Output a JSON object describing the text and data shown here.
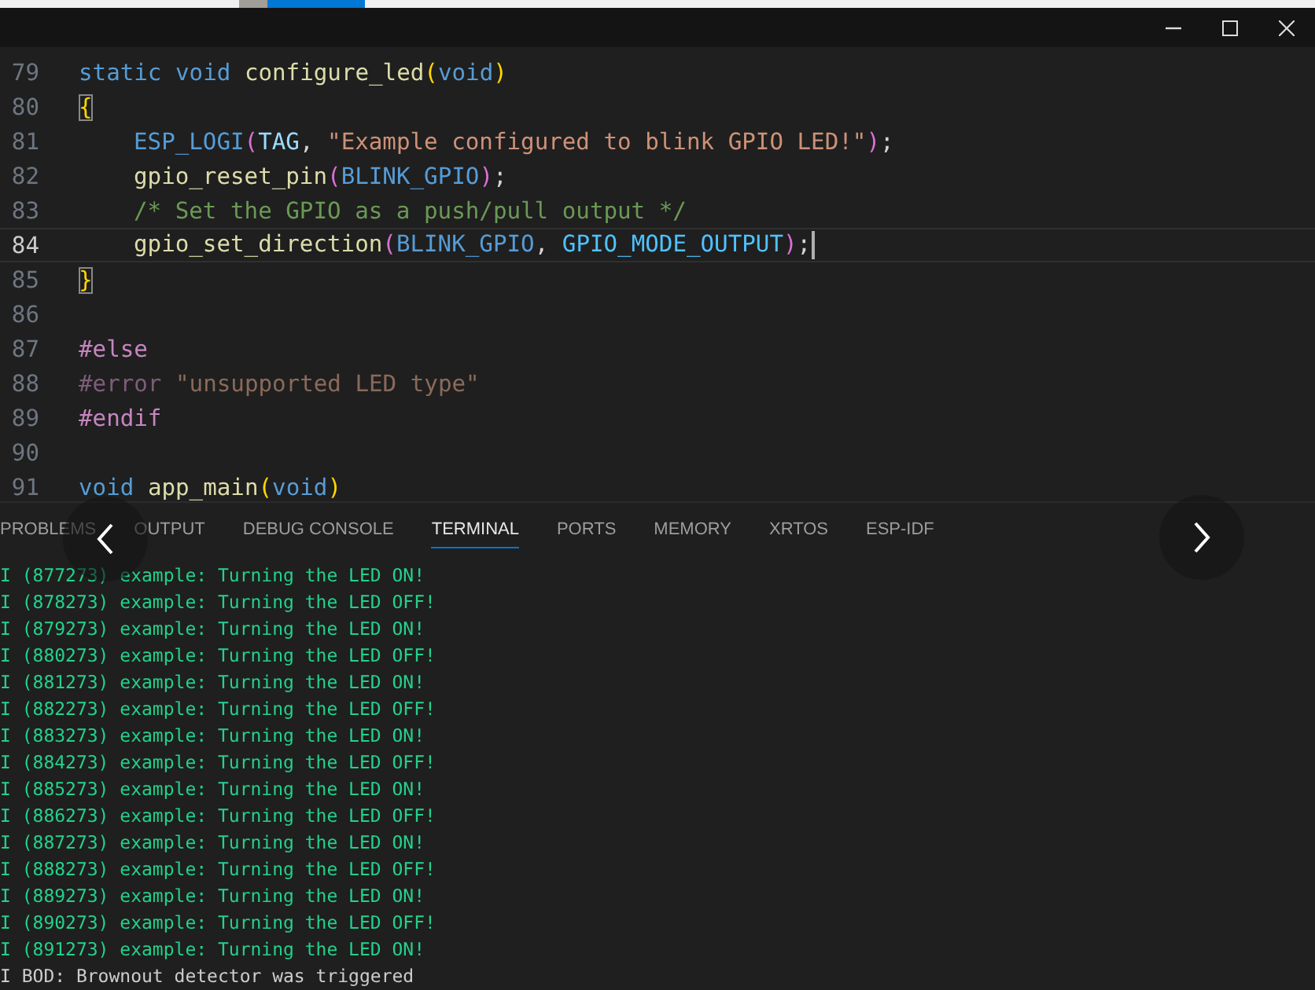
{
  "window": {
    "controls": [
      {
        "kind": "minimize"
      },
      {
        "kind": "maximize"
      },
      {
        "kind": "close"
      }
    ]
  },
  "editor": {
    "lines": [
      {
        "number": "79",
        "current": false,
        "tokens": [
          {
            "kind": "keyword",
            "text": "static void "
          },
          {
            "kind": "function",
            "text": "configure_led"
          },
          {
            "kind": "paren",
            "text": "("
          },
          {
            "kind": "keyword",
            "text": "void"
          },
          {
            "kind": "paren",
            "text": ")"
          }
        ]
      },
      {
        "number": "80",
        "current": false,
        "tokens": [
          {
            "kind": "match",
            "text": "{"
          }
        ]
      },
      {
        "number": "81",
        "current": false,
        "indented": true,
        "tokens": [
          {
            "kind": "macro",
            "text": "ESP_LOGI"
          },
          {
            "kind": "paren2",
            "text": "("
          },
          {
            "kind": "variable",
            "text": "TAG"
          },
          {
            "kind": "plain",
            "text": ", "
          },
          {
            "kind": "string",
            "text": "\"Example configured to blink GPIO LED!\""
          },
          {
            "kind": "paren2",
            "text": ")"
          },
          {
            "kind": "plain",
            "text": ";"
          }
        ]
      },
      {
        "number": "82",
        "current": false,
        "indented": true,
        "tokens": [
          {
            "kind": "function",
            "text": "gpio_reset_pin"
          },
          {
            "kind": "paren2",
            "text": "("
          },
          {
            "kind": "macro",
            "text": "BLINK_GPIO"
          },
          {
            "kind": "paren2",
            "text": ")"
          },
          {
            "kind": "plain",
            "text": ";"
          }
        ]
      },
      {
        "number": "83",
        "current": false,
        "indented": true,
        "tokens": [
          {
            "kind": "comment",
            "text": "/* Set the GPIO as a push/pull output */"
          }
        ]
      },
      {
        "number": "84",
        "current": true,
        "indented": true,
        "tokens": [
          {
            "kind": "function",
            "text": "gpio_set_direction"
          },
          {
            "kind": "paren2",
            "text": "("
          },
          {
            "kind": "macro",
            "text": "BLINK_GPIO"
          },
          {
            "kind": "plain",
            "text": ", "
          },
          {
            "kind": "constant",
            "text": "GPIO_MODE_OUTPUT"
          },
          {
            "kind": "paren2",
            "text": ")"
          },
          {
            "kind": "plain",
            "text": ";"
          }
        ]
      },
      {
        "number": "85",
        "current": false,
        "tokens": [
          {
            "kind": "match",
            "text": "}"
          }
        ]
      },
      {
        "number": "86",
        "current": false
      },
      {
        "number": "87",
        "current": false,
        "tokens": [
          {
            "kind": "preprocessor",
            "text": "#else"
          }
        ]
      },
      {
        "number": "88",
        "current": false,
        "tokens": [
          {
            "kind": "preprocessor-dim",
            "text": "#error "
          },
          {
            "kind": "string-dim",
            "text": "\"unsupported LED type\""
          }
        ]
      },
      {
        "number": "89",
        "current": false,
        "tokens": [
          {
            "kind": "preprocessor",
            "text": "#endif"
          }
        ]
      },
      {
        "number": "90",
        "current": false
      },
      {
        "number": "91",
        "current": false,
        "tokens": [
          {
            "kind": "keyword",
            "text": "void "
          },
          {
            "kind": "function",
            "text": "app_main"
          },
          {
            "kind": "paren",
            "text": "("
          },
          {
            "kind": "keyword",
            "text": "void"
          },
          {
            "kind": "paren",
            "text": ")"
          }
        ]
      }
    ]
  },
  "panel": {
    "tabs": [
      {
        "label": "PROBLEMS",
        "selected": false
      },
      {
        "label": "OUTPUT",
        "selected": false
      },
      {
        "label": "DEBUG CONSOLE",
        "selected": false
      },
      {
        "label": "TERMINAL",
        "selected": true
      },
      {
        "label": "PORTS",
        "selected": false
      },
      {
        "label": "MEMORY",
        "selected": false
      },
      {
        "label": "XRTOS",
        "selected": false
      },
      {
        "label": "ESP-IDF",
        "selected": false
      }
    ],
    "terminal": [
      {
        "kind": "info",
        "text": "I (877273) example: Turning the LED ON!"
      },
      {
        "kind": "info",
        "text": "I (878273) example: Turning the LED OFF!"
      },
      {
        "kind": "info",
        "text": "I (879273) example: Turning the LED ON!"
      },
      {
        "kind": "info",
        "text": "I (880273) example: Turning the LED OFF!"
      },
      {
        "kind": "info",
        "text": "I (881273) example: Turning the LED ON!"
      },
      {
        "kind": "info",
        "text": "I (882273) example: Turning the LED OFF!"
      },
      {
        "kind": "info",
        "text": "I (883273) example: Turning the LED ON!"
      },
      {
        "kind": "info",
        "text": "I (884273) example: Turning the LED OFF!"
      },
      {
        "kind": "info",
        "text": "I (885273) example: Turning the LED ON!"
      },
      {
        "kind": "info",
        "text": "I (886273) example: Turning the LED OFF!"
      },
      {
        "kind": "info",
        "text": "I (887273) example: Turning the LED ON!"
      },
      {
        "kind": "info",
        "text": "I (888273) example: Turning the LED OFF!"
      },
      {
        "kind": "info",
        "text": "I (889273) example: Turning the LED ON!"
      },
      {
        "kind": "info",
        "text": "I (890273) example: Turning the LED OFF!"
      },
      {
        "kind": "info",
        "text": "I (891273) example: Turning the LED ON!"
      },
      {
        "kind": "plain",
        "text": "I BOD: Brownout detector was triggered"
      }
    ]
  },
  "viewer": {
    "previous": true,
    "next": true
  }
}
